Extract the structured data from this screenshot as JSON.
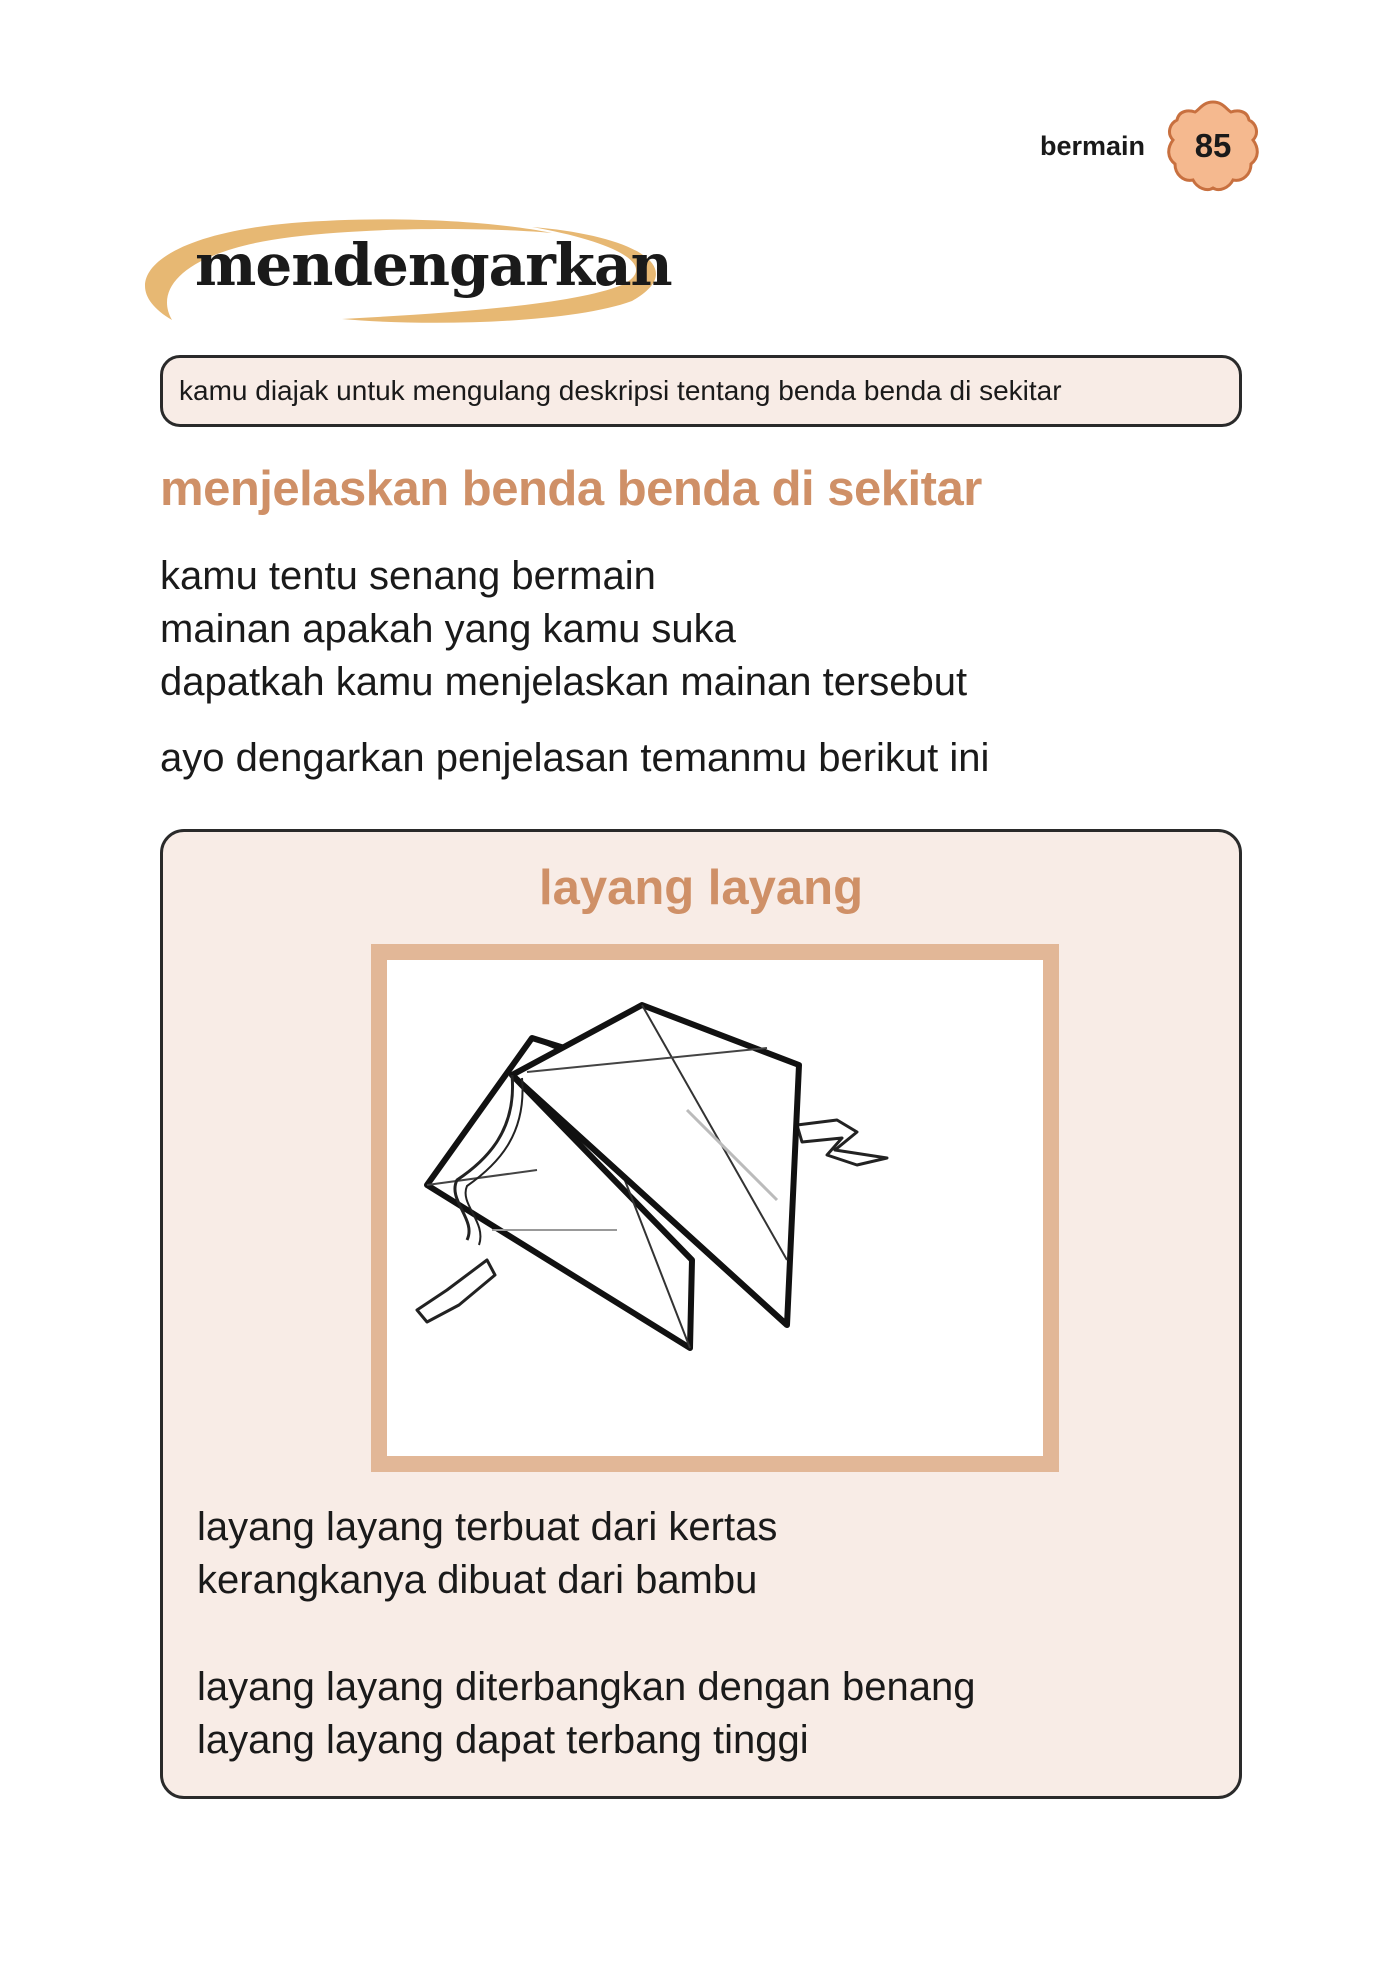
{
  "header": {
    "chapter": "bermain",
    "page_number": "85"
  },
  "section": {
    "title": "mendengarkan"
  },
  "instruction": "kamu diajak untuk mengulang deskripsi tentang benda benda di sekitar",
  "subheading": "menjelaskan benda benda di sekitar",
  "intro_lines": [
    "kamu tentu senang bermain",
    "mainan apakah yang kamu suka",
    "dapatkah kamu menjelaskan mainan tersebut",
    "ayo dengarkan penjelasan temanmu berikut ini"
  ],
  "card": {
    "title": "layang layang",
    "paragraphs": [
      [
        "layang layang terbuat dari kertas",
        "kerangkanya dibuat dari bambu"
      ],
      [
        "layang layang diterbangkan dengan benang",
        "layang layang dapat terbang tinggi"
      ]
    ]
  },
  "colors": {
    "accent": "#cf9067",
    "banner_swoosh": "#e7b873",
    "badge_fill": "#f5b98f",
    "badge_stroke": "#c8703f",
    "panel_bg": "#f8ece6",
    "frame": "#e2b797"
  }
}
